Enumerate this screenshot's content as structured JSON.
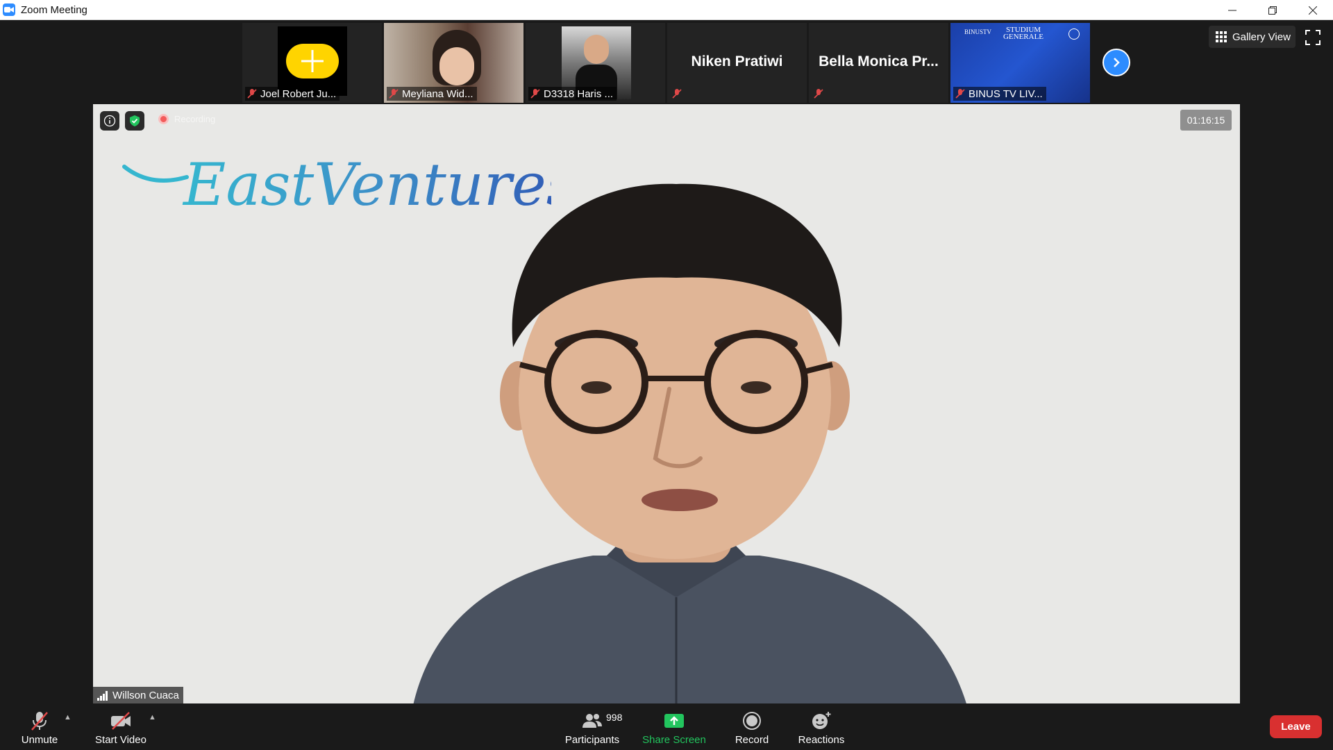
{
  "window": {
    "title": "Zoom Meeting"
  },
  "participants_strip": [
    {
      "name": "Joel Robert Ju...",
      "muted": true,
      "type": "avatar"
    },
    {
      "name": "Meyliana Wid...",
      "muted": true,
      "type": "video"
    },
    {
      "name": "D3318 Haris ...",
      "muted": true,
      "type": "video"
    },
    {
      "name": "",
      "display_name": "Niken Pratiwi",
      "muted": true,
      "type": "name-only"
    },
    {
      "name": "",
      "display_name": "Bella  Monica  Pr...",
      "muted": true,
      "type": "name-only"
    },
    {
      "name": "BINUS TV LIV...",
      "muted": true,
      "type": "video",
      "overlay_text": "STUDIUM GENERALE"
    }
  ],
  "view": {
    "gallery_label": "Gallery View"
  },
  "main_video": {
    "logo_text": "EastVentures",
    "recording_label": "Recording",
    "timer": "01:16:15",
    "speaker_name": "Willson Cuaca"
  },
  "toolbar": {
    "unmute_label": "Unmute",
    "start_video_label": "Start Video",
    "participants_label": "Participants",
    "participants_count": "998",
    "share_label": "Share Screen",
    "record_label": "Record",
    "reactions_label": "Reactions",
    "leave_label": "Leave"
  },
  "colors": {
    "accent": "#2d8cff",
    "leave": "#d93030",
    "share": "#22c55e",
    "muted_red": "#e04848"
  }
}
